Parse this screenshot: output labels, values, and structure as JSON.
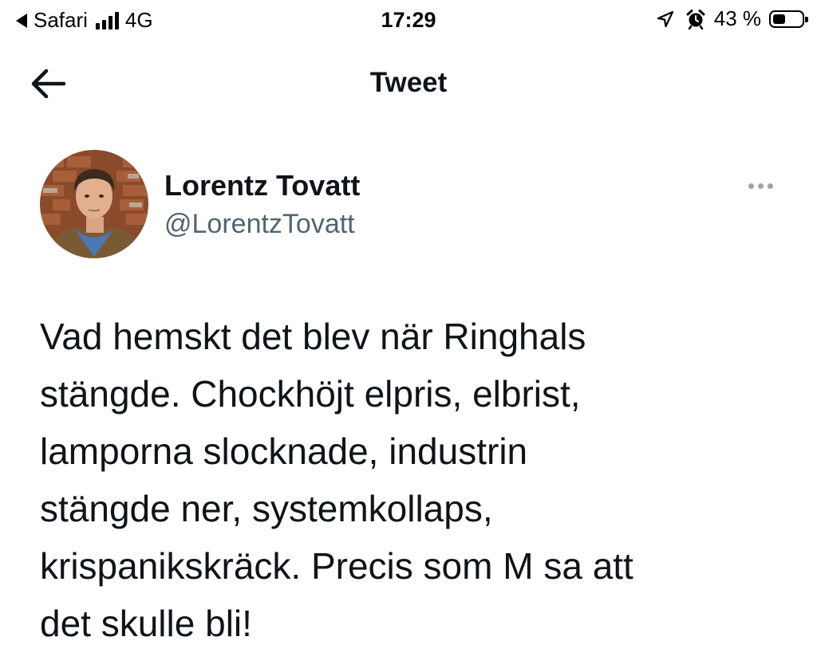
{
  "status_bar": {
    "back_app": "Safari",
    "network": "4G",
    "time": "17:29",
    "battery_percent": "43 %",
    "battery_level": 0.43,
    "icons": [
      "back-triangle-icon",
      "signal-icon",
      "location-icon",
      "alarm-icon",
      "battery-icon"
    ]
  },
  "nav": {
    "title": "Tweet",
    "back_icon": "arrow-left-icon"
  },
  "tweet": {
    "author_name": "Lorentz Tovatt",
    "author_handle": "@LorentzTovatt",
    "more_icon": "more-dots-icon",
    "text": "Vad hemskt det blev när Ringhals\nstängde. Chockhöjt elpris, elbrist,\nlamporna slocknade, industrin\nstängde ner, systemkollaps,\nkrispanikskräck. Precis som M sa att\ndet skulle bli!"
  },
  "colors": {
    "text_primary": "#0f1419",
    "text_secondary": "#536471",
    "background": "#ffffff"
  }
}
